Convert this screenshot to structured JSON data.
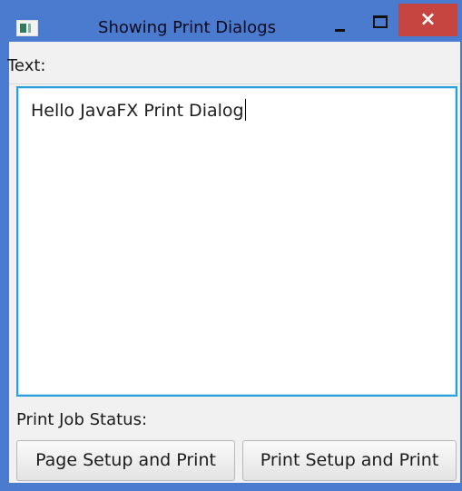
{
  "window": {
    "title": "Showing Print Dialogs",
    "close_symbol": "×",
    "frame_color": "#4a7bcf",
    "close_color": "#c74541"
  },
  "content": {
    "text_label": "Text:",
    "text_value": "Hello JavaFX Print Dialog",
    "status_label": "Print Job Status:"
  },
  "buttons": {
    "page_setup": "Page Setup and Print",
    "print_setup": "Print Setup and Print"
  },
  "icons": {
    "app": "app-icon",
    "minimize": "minimize-icon",
    "maximize": "maximize-icon",
    "close": "close-icon"
  }
}
